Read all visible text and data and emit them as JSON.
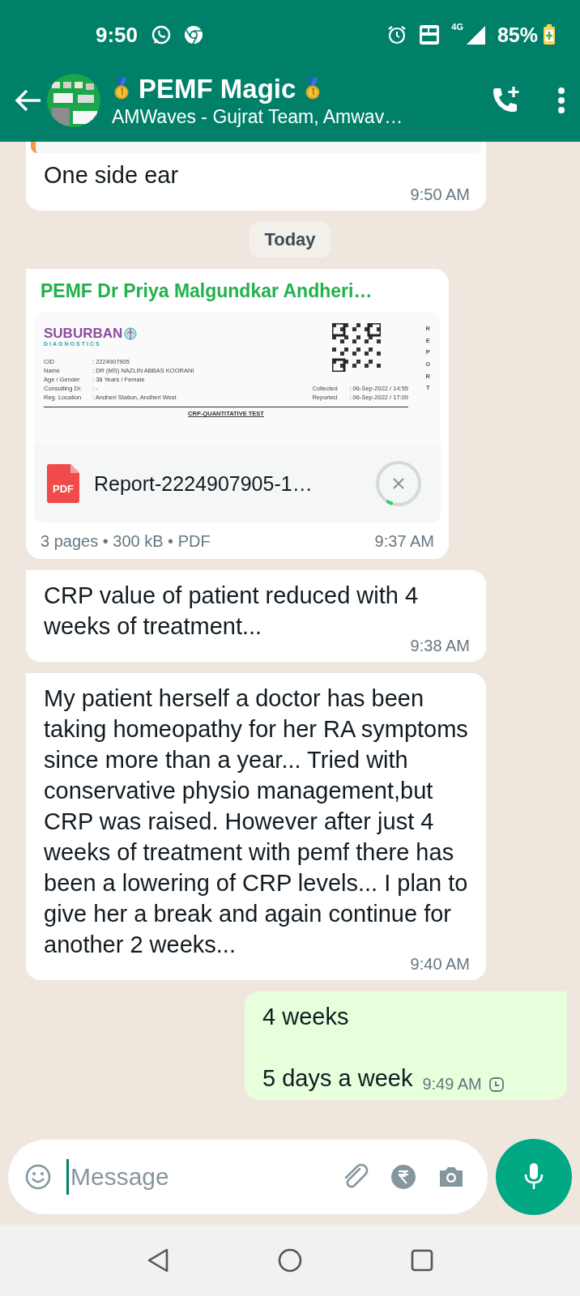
{
  "status_bar": {
    "time": "9:50",
    "battery": "85%",
    "network": "4G"
  },
  "header": {
    "title": "PEMF Magic",
    "subtitle": "AMWaves - Gujrat Team, Amwav…"
  },
  "messages": [
    {
      "kind": "text",
      "outgoing": false,
      "quoted": true,
      "text": "One side ear",
      "time": "9:50 AM"
    },
    {
      "kind": "date",
      "text": "Today"
    },
    {
      "kind": "document",
      "outgoing": false,
      "file_type": "PDF",
      "sender": "PEMF Dr Priya Malgundkar Andheri…",
      "file_name": "Report-2224907905-1…",
      "meta": "3 pages • 300 kB • PDF",
      "time": "9:37 AM",
      "download": {
        "level": 0.03
      },
      "preview": {
        "lab": "SUBURBAN",
        "lab_sub": "DIAGNOSTICS",
        "stamp": "REPORT",
        "test": "CRP-QUANTITATIVE TEST",
        "fields": [
          {
            "label": "CID",
            "value": ": 2224907905"
          },
          {
            "label": "Name",
            "value": ": DR (MS) NAZLIN ABBAS KOORANI"
          },
          {
            "label": "Age / Gender",
            "value": ": 38 Years / Female"
          },
          {
            "label": "Consulting Dr.",
            "value": ": -"
          },
          {
            "label": "Reg. Location",
            "value": ": Andheri Station, Andheri West"
          }
        ],
        "dates": [
          {
            "label": "Collected",
            "value": ": 06-Sep-2022 / 14:55"
          },
          {
            "label": "Reported",
            "value": ": 06-Sep-2022 / 17:09"
          }
        ]
      }
    },
    {
      "kind": "text",
      "outgoing": false,
      "text": "CRP value of patient reduced with 4 weeks of treatment...",
      "time": "9:38 AM"
    },
    {
      "kind": "text",
      "outgoing": false,
      "text": "My patient herself a doctor has been taking homeopathy for her RA symptoms since more than a year... Tried with conservative physio management,but CRP was raised. However after just 4 weeks of treatment with pemf there has been a lowering of CRP levels... I plan to give her a break and again continue for another 2 weeks...",
      "time": "9:40 AM"
    },
    {
      "kind": "text",
      "outgoing": true,
      "text": "4 weeks\n\n5 days a week",
      "time": "9:49 AM",
      "pending": true
    }
  ],
  "composer": {
    "placeholder": "Message"
  }
}
